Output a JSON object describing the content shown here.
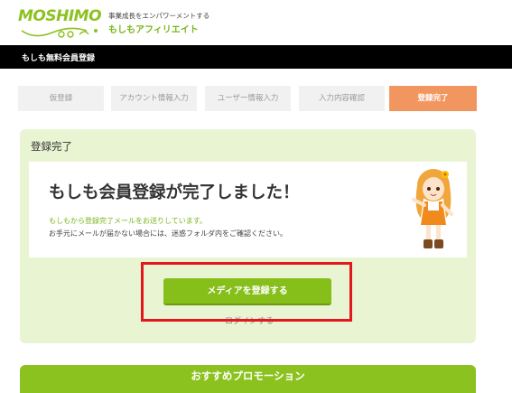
{
  "header": {
    "logo": "MOSHIMO",
    "tagline_top": "事業成長をエンパワーメントする",
    "tagline_main": "もしもアフィリエイト"
  },
  "titlebar": {
    "title": "もしも無料会員登録"
  },
  "steps": [
    {
      "label": "仮登録",
      "active": false
    },
    {
      "label": "アカウント情報入力",
      "active": false
    },
    {
      "label": "ユーザー情報入力",
      "active": false
    },
    {
      "label": "入力内容確認",
      "active": false
    },
    {
      "label": "登録完了",
      "active": true
    }
  ],
  "panel": {
    "title": "登録完了",
    "headline": "もしも会員登録が完了しました！",
    "message_green": "もしもから登録完了メールをお送りしています。",
    "message_gray": "お手元にメールが届かない場合には、迷惑フォルダ内をご確認ください。",
    "cta_label": "メディアを登録する",
    "login_label": "ログインする"
  },
  "promo": {
    "title": "おすすめプロモーション"
  },
  "colors": {
    "brand_green": "#8cc21f",
    "active_step": "#f29660",
    "panel_bg": "#e9f4d3",
    "highlight": "#e3181d"
  }
}
